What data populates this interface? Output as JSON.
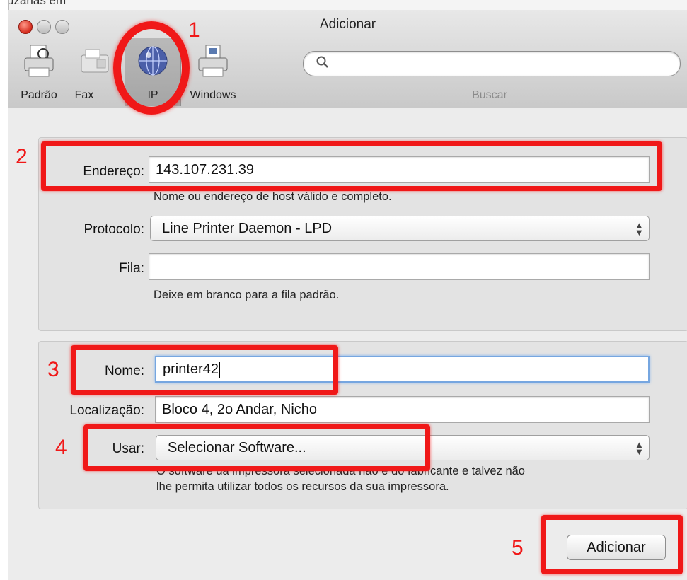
{
  "background": {
    "partial_text": "üzanas em"
  },
  "window": {
    "title": "Adicionar",
    "toolbar": [
      {
        "label": "Padrão",
        "icon": "default-printer-icon",
        "selected": false
      },
      {
        "label": "Fax",
        "icon": "fax-icon",
        "selected": false
      },
      {
        "label": "IP",
        "icon": "globe-icon",
        "selected": true
      },
      {
        "label": "Windows",
        "icon": "windows-printer-icon",
        "selected": false
      }
    ],
    "search": {
      "placeholder": "",
      "value": "",
      "label": "Buscar"
    }
  },
  "ip_group": {
    "address_label": "Endereço:",
    "address_value": "143.107.231.39",
    "address_hint": "Nome ou endereço de host válido e completo.",
    "protocol_label": "Protocolo:",
    "protocol_value": "Line Printer Daemon - LPD",
    "queue_label": "Fila:",
    "queue_value": "",
    "queue_hint": "Deixe em branco para a fila padrão."
  },
  "printer_group": {
    "name_label": "Nome:",
    "name_value": "printer42",
    "location_label": "Localização:",
    "location_value": "Bloco 4, 2o Andar, Nicho",
    "use_label": "Usar:",
    "use_value": "Selecionar Software...",
    "use_hint_1": "O software da impressora selecionada não é do fabricante e talvez não",
    "use_hint_2": "lhe permita utilizar todos os recursos da sua impressora."
  },
  "add_button": "Adicionar",
  "annotations": [
    "1",
    "2",
    "3",
    "4",
    "5"
  ],
  "colors": {
    "annotation": "#f01818",
    "focus_ring": "#76a6e0"
  }
}
